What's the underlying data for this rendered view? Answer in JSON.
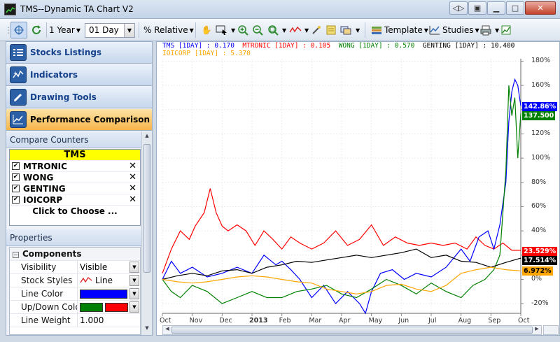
{
  "window": {
    "title": "TMS--Dynamic TA Chart V2"
  },
  "toolbar": {
    "period": "1 Year",
    "interval": "01 Day",
    "scale_mode": "% Relative",
    "template_label": "Template",
    "studies_label": "Studies"
  },
  "sidebar": {
    "nav": [
      {
        "label": "Stocks Listings"
      },
      {
        "label": "Indicators"
      },
      {
        "label": "Drawing Tools"
      },
      {
        "label": "Performance Comparison"
      }
    ],
    "compare_header": "Compare Counters",
    "base_counter": "TMS",
    "counters": [
      {
        "name": "MTRONIC",
        "checked": true
      },
      {
        "name": "WONG",
        "checked": true
      },
      {
        "name": "GENTING",
        "checked": true
      },
      {
        "name": "IOICORP",
        "checked": true
      }
    ],
    "choose_label": "Click to Choose ...",
    "properties_header": "Properties",
    "properties": {
      "group": "Components",
      "visibility_label": "Visibility",
      "visibility_value": "Visible",
      "stock_styles_label": "Stock Styles",
      "stock_styles_value": "Line",
      "line_color_label": "Line Color",
      "line_color": "#0000ff",
      "updown_label": "Up/Down Colo",
      "up_color": "#008000",
      "down_color": "#ff0000",
      "line_weight_label": "Line Weight",
      "line_weight_value": "1.000"
    }
  },
  "chart_data": {
    "type": "line",
    "y_unit": "% relative change",
    "ylim": [
      -28,
      182
    ],
    "y_ticks": [
      "180%",
      "160%",
      "140%",
      "120%",
      "100%",
      "80%",
      "60%",
      "40%",
      "20%",
      "0%",
      "-20%"
    ],
    "x_ticks": [
      "Oct",
      "Nov",
      "Dec",
      "2013",
      "Feb",
      "Mar",
      "Apr",
      "May",
      "Jun",
      "Jul",
      "Aug",
      "Sep",
      "Oct"
    ],
    "legend": [
      {
        "text": "TMS [1DAY] : 0.170",
        "color": "#0000ff"
      },
      {
        "text": "MTRONIC [1DAY] : 0.105",
        "color": "#ff0000"
      },
      {
        "text": "WONG [1DAY] : 0.570",
        "color": "#008000"
      },
      {
        "text": "GENTING [1DAY] : 10.400",
        "color": "#000000"
      },
      {
        "text": "IOICORP [1DAY] : 5.370",
        "color": "#ffa500"
      }
    ],
    "last_values": [
      {
        "series": "TMS",
        "label": "142.86%",
        "value": 142.86,
        "color": "#0000ff"
      },
      {
        "series": "WONG",
        "label": "137.500",
        "value": 137.5,
        "color": "#008000"
      },
      {
        "series": "MTRONIC",
        "label": "23.529%",
        "value": 23.529,
        "color": "#ff0000"
      },
      {
        "series": "GENTING",
        "label": "17.514%",
        "value": 17.514,
        "color": "#000000"
      },
      {
        "series": "IOICORP",
        "label": "6.972%",
        "value": 6.972,
        "color": "#ffa500"
      }
    ],
    "series": [
      {
        "name": "MTRONIC",
        "color": "#ff0000",
        "x": [
          0,
          0.3,
          0.6,
          0.9,
          1.1,
          1.4,
          1.6,
          1.8,
          2.0,
          2.2,
          2.5,
          2.8,
          3.1,
          3.4,
          3.7,
          4.0,
          4.3,
          4.6,
          5.0,
          5.4,
          5.8,
          6.2,
          6.6,
          7.0,
          7.4,
          7.8,
          8.2,
          8.6,
          9.0,
          9.4,
          9.8,
          10.2,
          10.5,
          10.8,
          11.1,
          11.4,
          11.7,
          12.0
        ],
        "y": [
          5,
          25,
          40,
          33,
          44,
          55,
          75,
          55,
          44,
          40,
          45,
          40,
          28,
          40,
          33,
          25,
          35,
          30,
          25,
          30,
          40,
          28,
          33,
          45,
          28,
          35,
          30,
          28,
          30,
          28,
          30,
          25,
          35,
          28,
          25,
          30,
          24,
          24
        ]
      },
      {
        "name": "TMS",
        "color": "#0000ff",
        "x": [
          0,
          0.3,
          0.6,
          1.0,
          1.5,
          2.0,
          2.5,
          3.0,
          3.4,
          3.8,
          4.0,
          4.3,
          4.6,
          5.0,
          5.4,
          5.8,
          6.2,
          6.6,
          6.8,
          7.0,
          7.3,
          7.7,
          8.1,
          8.5,
          9.0,
          9.5,
          10.0,
          10.3,
          10.6,
          10.9,
          11.1,
          11.3,
          11.5,
          11.6,
          11.7,
          11.8,
          11.9,
          12.0
        ],
        "y": [
          0,
          15,
          5,
          10,
          2,
          5,
          10,
          5,
          20,
          12,
          15,
          8,
          0,
          -15,
          -5,
          -20,
          -10,
          -20,
          -28,
          -10,
          5,
          8,
          0,
          5,
          2,
          10,
          25,
          15,
          35,
          40,
          25,
          45,
          80,
          130,
          155,
          165,
          160,
          143
        ]
      },
      {
        "name": "WONG",
        "color": "#008000",
        "x": [
          0,
          0.3,
          0.6,
          1.0,
          1.5,
          2.0,
          2.5,
          3.0,
          3.5,
          4.0,
          4.5,
          5.0,
          5.5,
          6.0,
          6.5,
          7.0,
          7.5,
          8.0,
          8.5,
          9.0,
          9.5,
          10.0,
          10.4,
          10.8,
          11.1,
          11.3,
          11.5,
          11.6,
          11.7,
          11.8,
          11.9,
          12.0
        ],
        "y": [
          0,
          -10,
          -15,
          -5,
          -10,
          -20,
          -15,
          -10,
          -15,
          -15,
          -10,
          -8,
          -5,
          -12,
          -15,
          -8,
          0,
          -5,
          -12,
          -3,
          -10,
          -15,
          -5,
          0,
          8,
          20,
          90,
          160,
          135,
          150,
          100,
          137
        ]
      },
      {
        "name": "GENTING",
        "color": "#000000",
        "x": [
          0,
          0.5,
          1.0,
          1.5,
          2.0,
          2.5,
          3.0,
          3.5,
          4.0,
          4.5,
          5.0,
          5.5,
          6.0,
          6.5,
          7.0,
          7.5,
          8.0,
          8.5,
          9.0,
          9.5,
          10.0,
          10.5,
          11.0,
          11.5,
          12.0
        ],
        "y": [
          0,
          3,
          5,
          3,
          7,
          8,
          5,
          10,
          12,
          15,
          14,
          16,
          18,
          20,
          18,
          20,
          22,
          25,
          18,
          20,
          15,
          14,
          10,
          14,
          17.5
        ]
      },
      {
        "name": "IOICORP",
        "color": "#ffa500",
        "x": [
          0,
          0.5,
          1.0,
          1.5,
          2.0,
          2.5,
          3.0,
          3.5,
          4.0,
          4.5,
          5.0,
          5.5,
          6.0,
          6.5,
          7.0,
          7.5,
          8.0,
          8.5,
          9.0,
          9.5,
          10.0,
          10.5,
          11.0,
          11.5,
          12.0
        ],
        "y": [
          0,
          -2,
          -3,
          -2,
          0,
          2,
          3,
          2,
          0,
          -2,
          -3,
          -8,
          -10,
          -12,
          -10,
          -5,
          -4,
          -8,
          -10,
          -5,
          5,
          8,
          10,
          8,
          7
        ]
      }
    ]
  }
}
